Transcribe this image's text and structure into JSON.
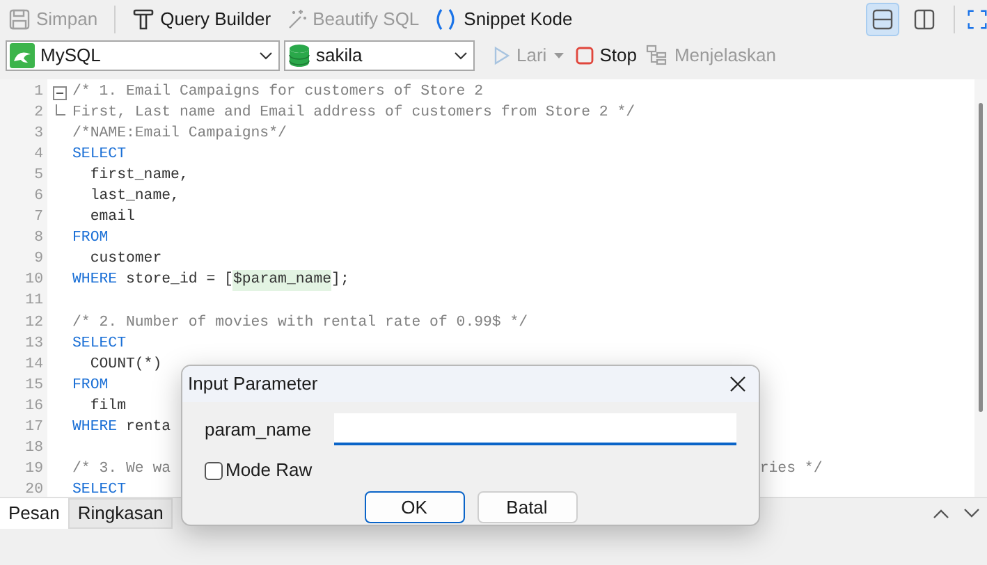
{
  "toolbar": {
    "buttons": [
      {
        "kind": "save",
        "label": "Simpan",
        "disabled": true
      },
      {
        "kind": "builder",
        "label": "Query Builder",
        "disabled": false
      },
      {
        "kind": "beautify",
        "label": "Beautify SQL",
        "disabled": true
      },
      {
        "kind": "snippet",
        "label": "Snippet Kode",
        "disabled": false
      }
    ],
    "layout_toggles": [
      {
        "kind": "horizontal",
        "selected": true
      },
      {
        "kind": "vertical",
        "selected": false
      }
    ]
  },
  "connection_bar": {
    "connection": "MySQL",
    "database": "sakila",
    "actions": [
      {
        "kind": "run",
        "label": "Lari",
        "disabled": true
      },
      {
        "kind": "stop",
        "label": "Stop",
        "disabled": false
      },
      {
        "kind": "explain",
        "label": "Menjelaskan",
        "disabled": true
      }
    ]
  },
  "editor": {
    "lines": [
      {
        "number": "1",
        "fold_start": true,
        "segments": [
          {
            "kind": "comment",
            "text": "/* 1. Email Campaigns for customers of Store 2"
          }
        ]
      },
      {
        "number": "2",
        "fold_end": true,
        "segments": [
          {
            "kind": "comment",
            "text": "First, Last name and Email address of customers from Store 2 */"
          }
        ]
      },
      {
        "number": "3",
        "segments": [
          {
            "kind": "comment",
            "text": "/*NAME:Email Campaigns*/"
          }
        ]
      },
      {
        "number": "4",
        "segments": [
          {
            "kind": "keyword",
            "text": "SELECT"
          }
        ]
      },
      {
        "number": "5",
        "segments": [
          {
            "kind": "text",
            "text": "  first_name,"
          }
        ]
      },
      {
        "number": "6",
        "segments": [
          {
            "kind": "text",
            "text": "  last_name,"
          }
        ]
      },
      {
        "number": "7",
        "segments": [
          {
            "kind": "text",
            "text": "  email"
          }
        ]
      },
      {
        "number": "8",
        "segments": [
          {
            "kind": "keyword",
            "text": "FROM"
          }
        ]
      },
      {
        "number": "9",
        "segments": [
          {
            "kind": "text",
            "text": "  customer"
          }
        ]
      },
      {
        "number": "10",
        "segments": [
          {
            "kind": "keyword",
            "text": "WHERE"
          },
          {
            "kind": "text",
            "text": " store_id = ["
          },
          {
            "kind": "param",
            "text": "$param_name"
          },
          {
            "kind": "text",
            "text": "];"
          }
        ]
      },
      {
        "number": "11"
      },
      {
        "number": "12",
        "segments": [
          {
            "kind": "comment",
            "text": "/* 2. Number of movies with rental rate of 0.99$ */"
          }
        ]
      },
      {
        "number": "13",
        "segments": [
          {
            "kind": "keyword",
            "text": "SELECT"
          }
        ]
      },
      {
        "number": "14",
        "segments": [
          {
            "kind": "text",
            "text": "  COUNT(*)"
          }
        ]
      },
      {
        "number": "15",
        "segments": [
          {
            "kind": "keyword",
            "text": "FROM"
          }
        ]
      },
      {
        "number": "16",
        "segments": [
          {
            "kind": "text",
            "text": "  film"
          }
        ]
      },
      {
        "number": "17",
        "segments": [
          {
            "kind": "keyword",
            "text": "WHERE"
          },
          {
            "kind": "text",
            "text": " renta"
          }
        ]
      },
      {
        "number": "18"
      },
      {
        "number": "19",
        "segments": [
          {
            "kind": "comment",
            "text": "/* 3. We wa"
          },
          {
            "kind": "comment_tail",
            "text": "ries */"
          }
        ]
      },
      {
        "number": "20",
        "segments": [
          {
            "kind": "keyword",
            "text": "SELECT"
          }
        ]
      }
    ]
  },
  "bottom_panel": {
    "tabs": [
      {
        "label": "Pesan",
        "selected": true
      },
      {
        "label": "Ringkasan",
        "selected": false
      }
    ]
  },
  "dialog": {
    "title": "Input Parameter",
    "field_label": "param_name",
    "raw_mode": {
      "label": "Mode Raw",
      "checked": false
    },
    "buttons": [
      {
        "label": "OK",
        "default": true
      },
      {
        "label": "Batal",
        "default": false
      }
    ]
  }
}
